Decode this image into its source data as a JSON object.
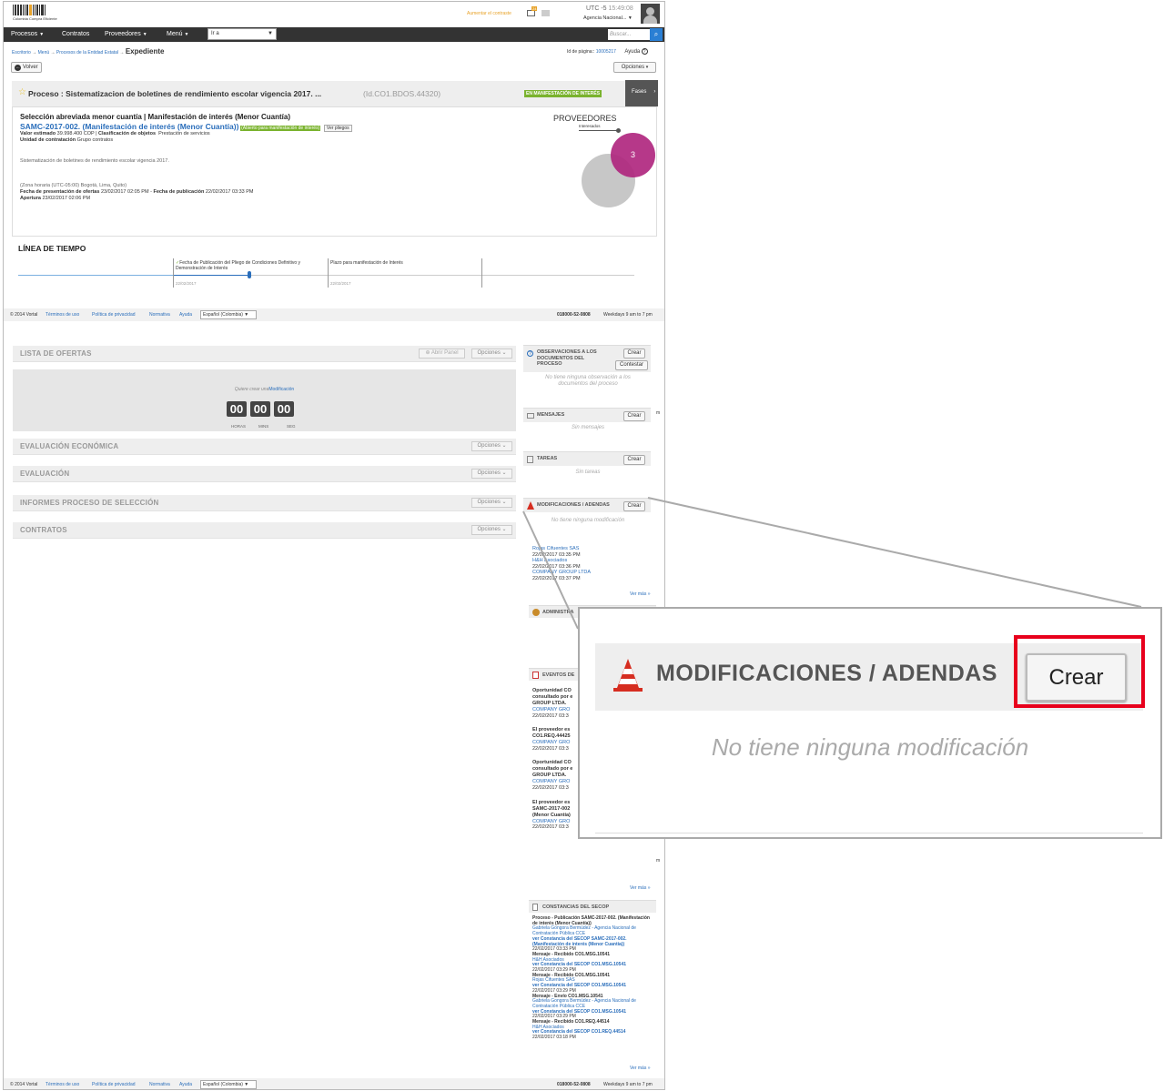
{
  "topbar": {
    "logo_text": "Colombia Compra Eficiente",
    "font_link": "Aumentar el contraste",
    "notif_count": "24",
    "utc_label": "UTC -5",
    "time": "15:49:08",
    "agency": "Agencia Nacional..."
  },
  "nav": {
    "items": [
      "Procesos",
      "Contratos",
      "Proveedores",
      "Menú"
    ],
    "goto": "Ir a",
    "search_placeholder": "Buscar..."
  },
  "breadcrumb": {
    "items": [
      "Escritorio",
      "Menú",
      "Procesos de la Entidad Estatal"
    ],
    "current": "Expediente",
    "page_id_label": "Id de página::",
    "page_id": "10005217",
    "help": "Ayuda"
  },
  "toolbar": {
    "back": "Volver",
    "options": "Opciones"
  },
  "process": {
    "title": "Proceso : Sistematizacion de boletines de rendimiento escolar vigencia 2017. ...",
    "id": "(Id.CO1.BDOS.44320)",
    "status": "EN MANIFESTACIÓN DE INTERÉS",
    "phases": "Fases",
    "type_line": "Selección abreviada menor cuantía | Manifestación de interés (Menor Cuantía)",
    "ref": "SAMC-2017-002. (Manifestación de interés (Menor Cuantía))",
    "ref_badge": "(Abierto para manifestación de interés)",
    "view_terms": "Ver pliegos",
    "value_label": "Valor estimado",
    "value": "39.998.400 COP",
    "class_label": "Clasificación de objetos",
    "class_value": "Prestación de servicios",
    "unit_label": "Unidad de contratación",
    "unit_value": "Grupo contratos",
    "description": "Sistematización de boletines de rendimiento escolar vigencia 2017.",
    "timezone": "(Zona horaria (UTC-05:00) Bogotá, Lima, Quito)",
    "offers_label": "Fecha de presentación de ofertas",
    "offers_date": "23/02/2017 02:05 PM",
    "pub_label": "Fecha de publicación",
    "pub_date": "22/02/2017 03:33 PM",
    "opening_label": "Apertura",
    "opening_date": "23/02/2017 02:06 PM"
  },
  "providers": {
    "title": "PROVEEDORES",
    "label": "Interesados",
    "count": "3"
  },
  "timeline": {
    "title": "LÍNEA DE TIEMPO",
    "events": [
      {
        "label": "Fecha de Publicación del Pliego de Condiciones Definitivo y Demonstración de Interés",
        "date": "22/02/2017"
      },
      {
        "label": "Plazo para manifestación de Interés",
        "date": "22/02/2017"
      }
    ]
  },
  "footer": {
    "copyright": "© 2014 Vortal",
    "links": [
      "Términos de uso",
      "Política de privacidad",
      "Normativa",
      "Ayuda"
    ],
    "language": "Español (Colombia)",
    "phone": "018000-52-0808",
    "hours": "Weekdays 9 am to 7 pm"
  },
  "offers": {
    "title": "LISTA DE OFERTAS",
    "open_panel": "Abrir Panel",
    "options": "Opciones",
    "prompt": "Quiere crear una",
    "prompt_link": "Modificación",
    "countdown": {
      "hours": "00",
      "mins": "00",
      "secs": "00",
      "hours_label": "HORAS",
      "mins_label": "MINS",
      "secs_label": "SEG"
    }
  },
  "panels": [
    "EVALUACIÓN ECONÓMICA",
    "EVALUACIÓN",
    "INFORMES PROCESO DE SELECCIÓN",
    "CONTRATOS"
  ],
  "sidebar": {
    "observations": {
      "title": "OBSERVACIONES A LOS DOCUMENTOS DEL PROCESO",
      "create": "Crear",
      "reply": "Contestar",
      "empty": "No tiene ninguna observación a los documentos del proceso"
    },
    "messages": {
      "title": "MENSAJES",
      "create": "Crear",
      "empty": "Sin mensajes"
    },
    "tasks": {
      "title": "TAREAS",
      "create": "Crear",
      "empty": "Sin tareas"
    },
    "modifications": {
      "title": "MODIFICACIONES / ADENDAS",
      "create": "Crear",
      "empty": "No tiene ninguna modificación"
    },
    "interested": [
      {
        "name": "Rojas Cifuentes SAS",
        "date": "22/02/2017 03:35 PM"
      },
      {
        "name": "H&H Asociados",
        "date": "22/02/2017 03:36 PM"
      },
      {
        "name": "COMPANY GROUP LTDA",
        "date": "22/02/2017 03:37 PM"
      }
    ],
    "see_more": "Ver más »",
    "admin_title": "ADMINISTRA",
    "events_title": "EVENTOS DE",
    "events": [
      {
        "text": "Oportunidad CO consultado por e GROUP LTDA.",
        "link": "COMPANY GRO",
        "date": "22/02/2017 03:3"
      },
      {
        "text": "El proveedor es CO1.REQ.44425",
        "link": "COMPANY GRO",
        "date": "22/02/2017 03:3"
      },
      {
        "text": "Oportunidad CO consultado por e GROUP LTDA.",
        "link": "COMPANY GRO",
        "date": "22/02/2017 03:3"
      },
      {
        "text": "El proveedor es SAMC-2017-002 (Menor Cuantía)",
        "link": "COMPANY GRO",
        "date": "22/02/2017 03:3"
      }
    ],
    "secop_title": "CONSTANCIAS DEL SECOP",
    "secop_lines": [
      {
        "t": "Proceso - Publicación SAMC-2017-002. (Manifestación de interés (Menor Cuantía))",
        "k": "b"
      },
      {
        "t": "Gabriela Gongora Bermúdez - Agencia Nacional de Contratación Pública CCE",
        "k": "l"
      },
      {
        "t": "ver Constancia del SECOP SAMC-2017-002. (Manifestación de interés (Menor Cuantía))",
        "k": "lb"
      },
      {
        "t": "22/02/2017 03:33 PM",
        "k": "d"
      },
      {
        "t": "Mensaje - Recibido CO1.MSG.10541",
        "k": "b"
      },
      {
        "t": "H&H Asociados",
        "k": "l"
      },
      {
        "t": "ver Constancia del SECOP CO1.MSG.10541",
        "k": "lb"
      },
      {
        "t": "22/02/2017 03:29 PM",
        "k": "d"
      },
      {
        "t": "Mensaje - Recibido CO1.MSG.10541",
        "k": "b"
      },
      {
        "t": "Rojas Cifuentes SAS",
        "k": "l"
      },
      {
        "t": "ver Constancia del SECOP CO1.MSG.10541",
        "k": "lb"
      },
      {
        "t": "22/02/2017 03:29 PM",
        "k": "d"
      },
      {
        "t": "Mensaje - Envío CO1.MSG.10541",
        "k": "b"
      },
      {
        "t": "Gabriela Gongora Bermúdez - Agencia Nacional de Contratación Pública CCE",
        "k": "l"
      },
      {
        "t": "ver Constancia del SECOP CO1.MSG.10541",
        "k": "lb"
      },
      {
        "t": "22/02/2017 03:29 PM",
        "k": "d"
      },
      {
        "t": "Mensaje - Recibido CO1.REQ.44514",
        "k": "b"
      },
      {
        "t": "H&H Asociados",
        "k": "l"
      },
      {
        "t": "ver Constancia del SECOP CO1.REQ.44514",
        "k": "lb"
      },
      {
        "t": "22/02/2017 03:18 PM",
        "k": "d"
      }
    ],
    "cut_a": "m",
    "cut_b": "m"
  },
  "callout": {
    "title": "MODIFICACIONES / ADENDAS",
    "button": "Crear",
    "empty": "No tiene ninguna modificación",
    "highlight_color": "#e8001c"
  }
}
